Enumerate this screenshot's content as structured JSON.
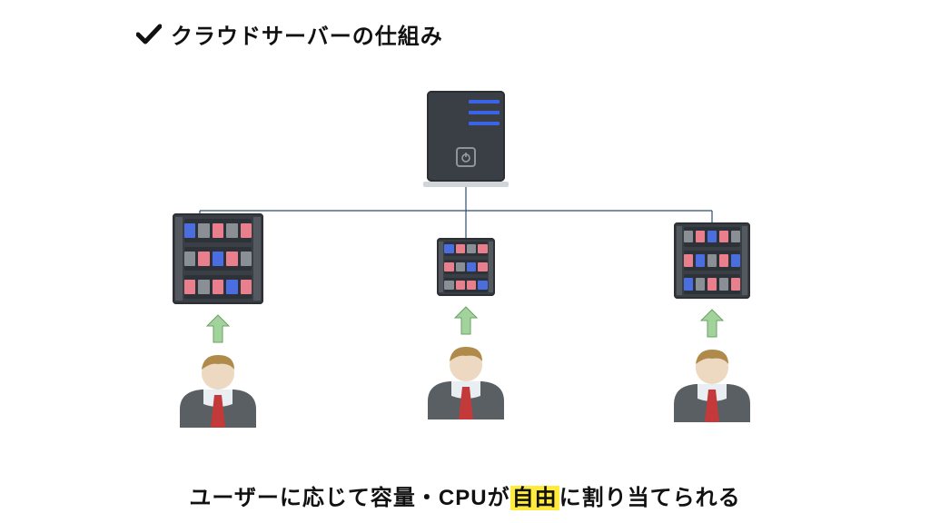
{
  "title": "クラウドサーバーの仕組み",
  "caption": {
    "pre": "ユーザーに応じて容量・CPUが",
    "highlight": "自由",
    "post": "に割り当てられる"
  },
  "icons": {
    "check": "check-icon",
    "power": "power-icon",
    "arrow": "up-arrow-icon"
  },
  "columns": {
    "left": {
      "role": "user-server",
      "size": "large"
    },
    "center": {
      "role": "user-server",
      "size": "small"
    },
    "right": {
      "role": "user-server",
      "size": "medium"
    }
  },
  "colors": {
    "line": "#2f4d6e",
    "arrow_fill": "#a3d39c",
    "arrow_stroke": "#6aa162",
    "tie": "#c43a3a",
    "highlight_bg": "#ffeb3b"
  }
}
